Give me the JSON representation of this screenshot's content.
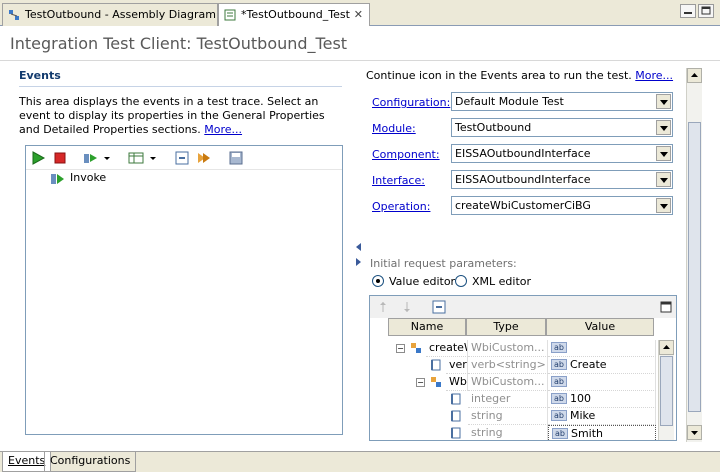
{
  "tabs": [
    {
      "label": "TestOutbound - Assembly Diagram"
    },
    {
      "label": "*TestOutbound_Test"
    }
  ],
  "header": {
    "title": "Integration Test Client: TestOutbound_Test"
  },
  "events": {
    "title": "Events",
    "description": "This area displays the events in a test trace. Select an event to display its properties in the General Properties and Detailed Properties sections.",
    "more_link": "More...",
    "items": [
      {
        "label": "Invoke"
      }
    ]
  },
  "details": {
    "intro": "Continue icon in the Events area to run the test.",
    "more_link": "More...",
    "fields": [
      {
        "label": "Configuration:",
        "value": "Default Module Test"
      },
      {
        "label": "Module:",
        "value": "TestOutbound"
      },
      {
        "label": "Component:",
        "value": "EISSAOutboundInterface"
      },
      {
        "label": "Interface:",
        "value": "EISSAOutboundInterface"
      },
      {
        "label": "Operation:",
        "value": "createWbiCustomerCiBG"
      }
    ],
    "initial_label": "Initial request parameters:",
    "radio_value": "Value editor",
    "radio_xml": "XML editor",
    "columns": [
      "Name",
      "Type",
      "Value"
    ],
    "rows": [
      {
        "name": "createW",
        "type": "WbiCustom...",
        "value": ""
      },
      {
        "name": "verb",
        "type": "verb<string>",
        "value": "Create"
      },
      {
        "name": "Wb",
        "type": "WbiCustom...",
        "value": ""
      },
      {
        "name": "",
        "type": "integer",
        "value": "100"
      },
      {
        "name": "",
        "type": "string",
        "value": "Mike"
      },
      {
        "name": "",
        "type": "string",
        "value": "Smith"
      }
    ]
  },
  "bottom_tabs": [
    {
      "label": "Events"
    },
    {
      "label": "Configurations"
    }
  ],
  "colors": {
    "link": "#0000cc",
    "section_title": "#123a6d",
    "border": "#7f9db9"
  }
}
